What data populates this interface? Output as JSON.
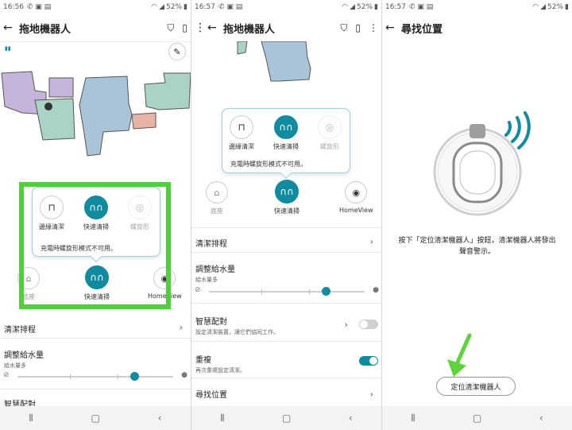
{
  "panel1": {
    "status": {
      "time": "16:56",
      "battery": "52%"
    },
    "title": "拖地機器人",
    "popup": {
      "modes": [
        {
          "label": "邊緣清潔",
          "icon": "edge-clean-icon"
        },
        {
          "label": "快速清掃",
          "icon": "quick-clean-icon"
        },
        {
          "label": "螺旋形",
          "icon": "spiral-icon"
        }
      ],
      "note": "充電時螺旋形模式不可用。"
    },
    "bottom_modes": [
      {
        "label": "底座",
        "icon": "dock-icon"
      },
      {
        "label": "快速清掃",
        "icon": "quick-clean-icon"
      },
      {
        "label": "HomeView",
        "icon": "camera-icon"
      }
    ],
    "rows": {
      "schedule": "清潔排程",
      "water": "調整給水量",
      "water_sub": "給水量多",
      "water_level": 0.75,
      "partial": "智慧配對"
    }
  },
  "panel2": {
    "status": {
      "time": "16:57",
      "battery": "52%"
    },
    "title": "拖地機器人",
    "popup": {
      "modes": [
        {
          "label": "邊緣清潔",
          "icon": "edge-clean-icon"
        },
        {
          "label": "快速清掃",
          "icon": "quick-clean-icon"
        },
        {
          "label": "螺旋形",
          "icon": "spiral-icon"
        }
      ],
      "note": "充電時螺旋形模式不可用。"
    },
    "bottom_modes": [
      {
        "label": "底座",
        "icon": "dock-icon"
      },
      {
        "label": "快速清掃",
        "icon": "quick-clean-icon"
      },
      {
        "label": "HomeView",
        "icon": "camera-icon"
      }
    ],
    "rows": {
      "schedule": "清潔排程",
      "water": "調整給水量",
      "water_sub": "給水量多",
      "water_level": 0.75,
      "pairing": "智慧配對",
      "pairing_sub": "設定清潔裝置，讓它們協同工作。",
      "pairing_on": false,
      "repeat": "重複",
      "repeat_sub": "再次重複設定清潔。",
      "repeat_on": true,
      "locate": "尋找位置"
    }
  },
  "panel3": {
    "status": {
      "time": "16:57",
      "battery": "52%"
    },
    "title": "尋找位置",
    "instruction_line1": "按下「定位清潔機器人」按鈕，清潔機器人將發出",
    "instruction_line2": "聲音警示。",
    "button": "定位清潔機器人"
  },
  "colors": {
    "accent": "#108ba0",
    "highlight": "#4cd137",
    "map_blue": "#a9c3d9",
    "map_purple": "#c5b4dc",
    "map_green": "#a9d4c4",
    "map_pink": "#e8b3a7"
  }
}
